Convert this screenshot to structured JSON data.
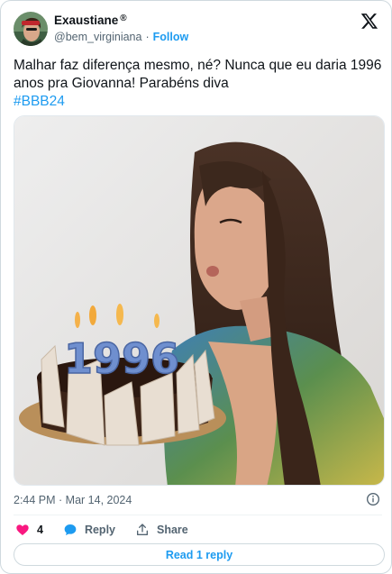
{
  "author": {
    "display_name": "Exaustiane",
    "badge": "®",
    "handle": "@bem_virginiana",
    "separator": "·",
    "follow_label": "Follow"
  },
  "tweet": {
    "text": "Malhar faz diferença mesmo, né? Nunca que eu daria 1996 anos pra Giovanna! Parabéns diva",
    "hashtag": "#BBB24",
    "timestamp": "2:44 PM · Mar 14, 2024"
  },
  "photo": {
    "cake_candles": "1996"
  },
  "actions": {
    "like_count": "4",
    "reply_label": "Reply",
    "share_label": "Share"
  },
  "read_reply_label": "Read 1 reply",
  "colors": {
    "accent": "#1d9bf0",
    "like": "#f91880",
    "text": "#0f1419",
    "muted": "#536471"
  }
}
